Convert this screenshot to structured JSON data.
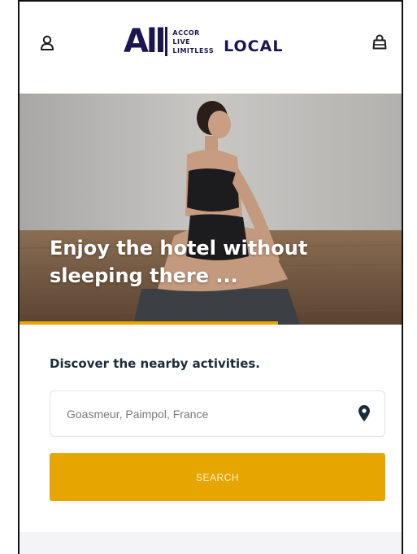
{
  "header": {
    "brand": {
      "all": "All",
      "line1": "ACCOR",
      "line2": "LIVE",
      "line3": "LIMITLESS",
      "local": "LOCAL"
    },
    "icons": {
      "account": "user-icon",
      "cart": "shopping-bag-icon"
    }
  },
  "hero": {
    "title": "Enjoy the hotel without sleeping there ..."
  },
  "search": {
    "heading": "Discover the nearby activities.",
    "location_value": "Goasmeur, Paimpol, France",
    "location_icon": "location-pin-icon",
    "button_label": "SEARCH"
  },
  "colors": {
    "brand_navy": "#1b1650",
    "accent": "#e6a500",
    "heading": "#1b2b3a",
    "footer_bg": "#f4f4f6"
  }
}
